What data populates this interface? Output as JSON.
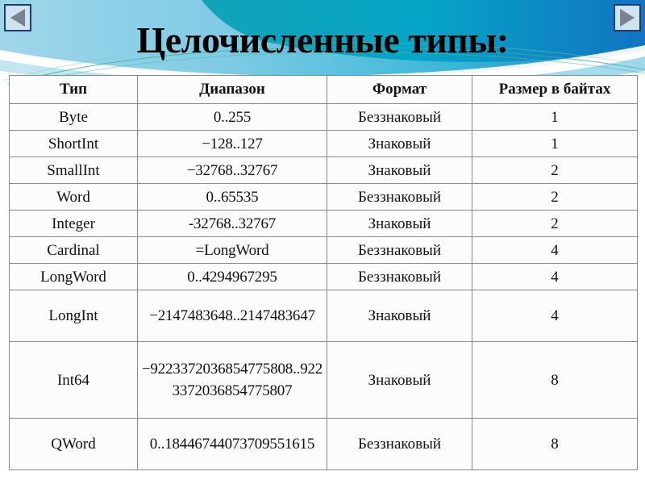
{
  "slide": {
    "title": "Целочисленные типы:",
    "accent_color": "#00a8cc",
    "title_color": "#000000",
    "background_color": "#ffffff"
  },
  "navigation": {
    "prev_label": "◀",
    "next_label": "▶",
    "prev_icon": "triangle-left-icon",
    "next_icon": "triangle-right-icon"
  },
  "table": {
    "headers": [
      "Тип",
      "Диапазон",
      "Формат",
      "Размер в байтах"
    ],
    "rows": [
      {
        "type": "Byte",
        "range": "0..255",
        "format": "Беззнаковый",
        "size": "1",
        "lines": 1
      },
      {
        "type": "ShortInt",
        "range": "−128..127",
        "format": "Знаковый",
        "size": "1",
        "lines": 1
      },
      {
        "type": "SmallInt",
        "range": "−32768..32767",
        "format": "Знаковый",
        "size": "2",
        "lines": 1
      },
      {
        "type": "Word",
        "range": "0..65535",
        "format": "Беззнаковый",
        "size": "2",
        "lines": 1
      },
      {
        "type": "Integer",
        "range": "-32768..32767",
        "format": "Знаковый",
        "size": "2",
        "lines": 1
      },
      {
        "type": "Cardinal",
        "range": "=LongWord",
        "format": "Беззнаковый",
        "size": "4",
        "lines": 1
      },
      {
        "type": "LongWord",
        "range": "0..4294967295",
        "format": "Беззнаковый",
        "size": "4",
        "lines": 1
      },
      {
        "type": "LongInt",
        "range": "−2147483648..2147483647",
        "format": "Знаковый",
        "size": "4",
        "lines": 2
      },
      {
        "type": "Int64",
        "range": "−9223372036854775808..9223372036854775807",
        "format": "Знаковый",
        "size": "8",
        "lines": 3
      },
      {
        "type": "QWord",
        "range": "0..18446744073709551615",
        "format": "Беззнаковый",
        "size": "8",
        "lines": 2
      }
    ]
  }
}
